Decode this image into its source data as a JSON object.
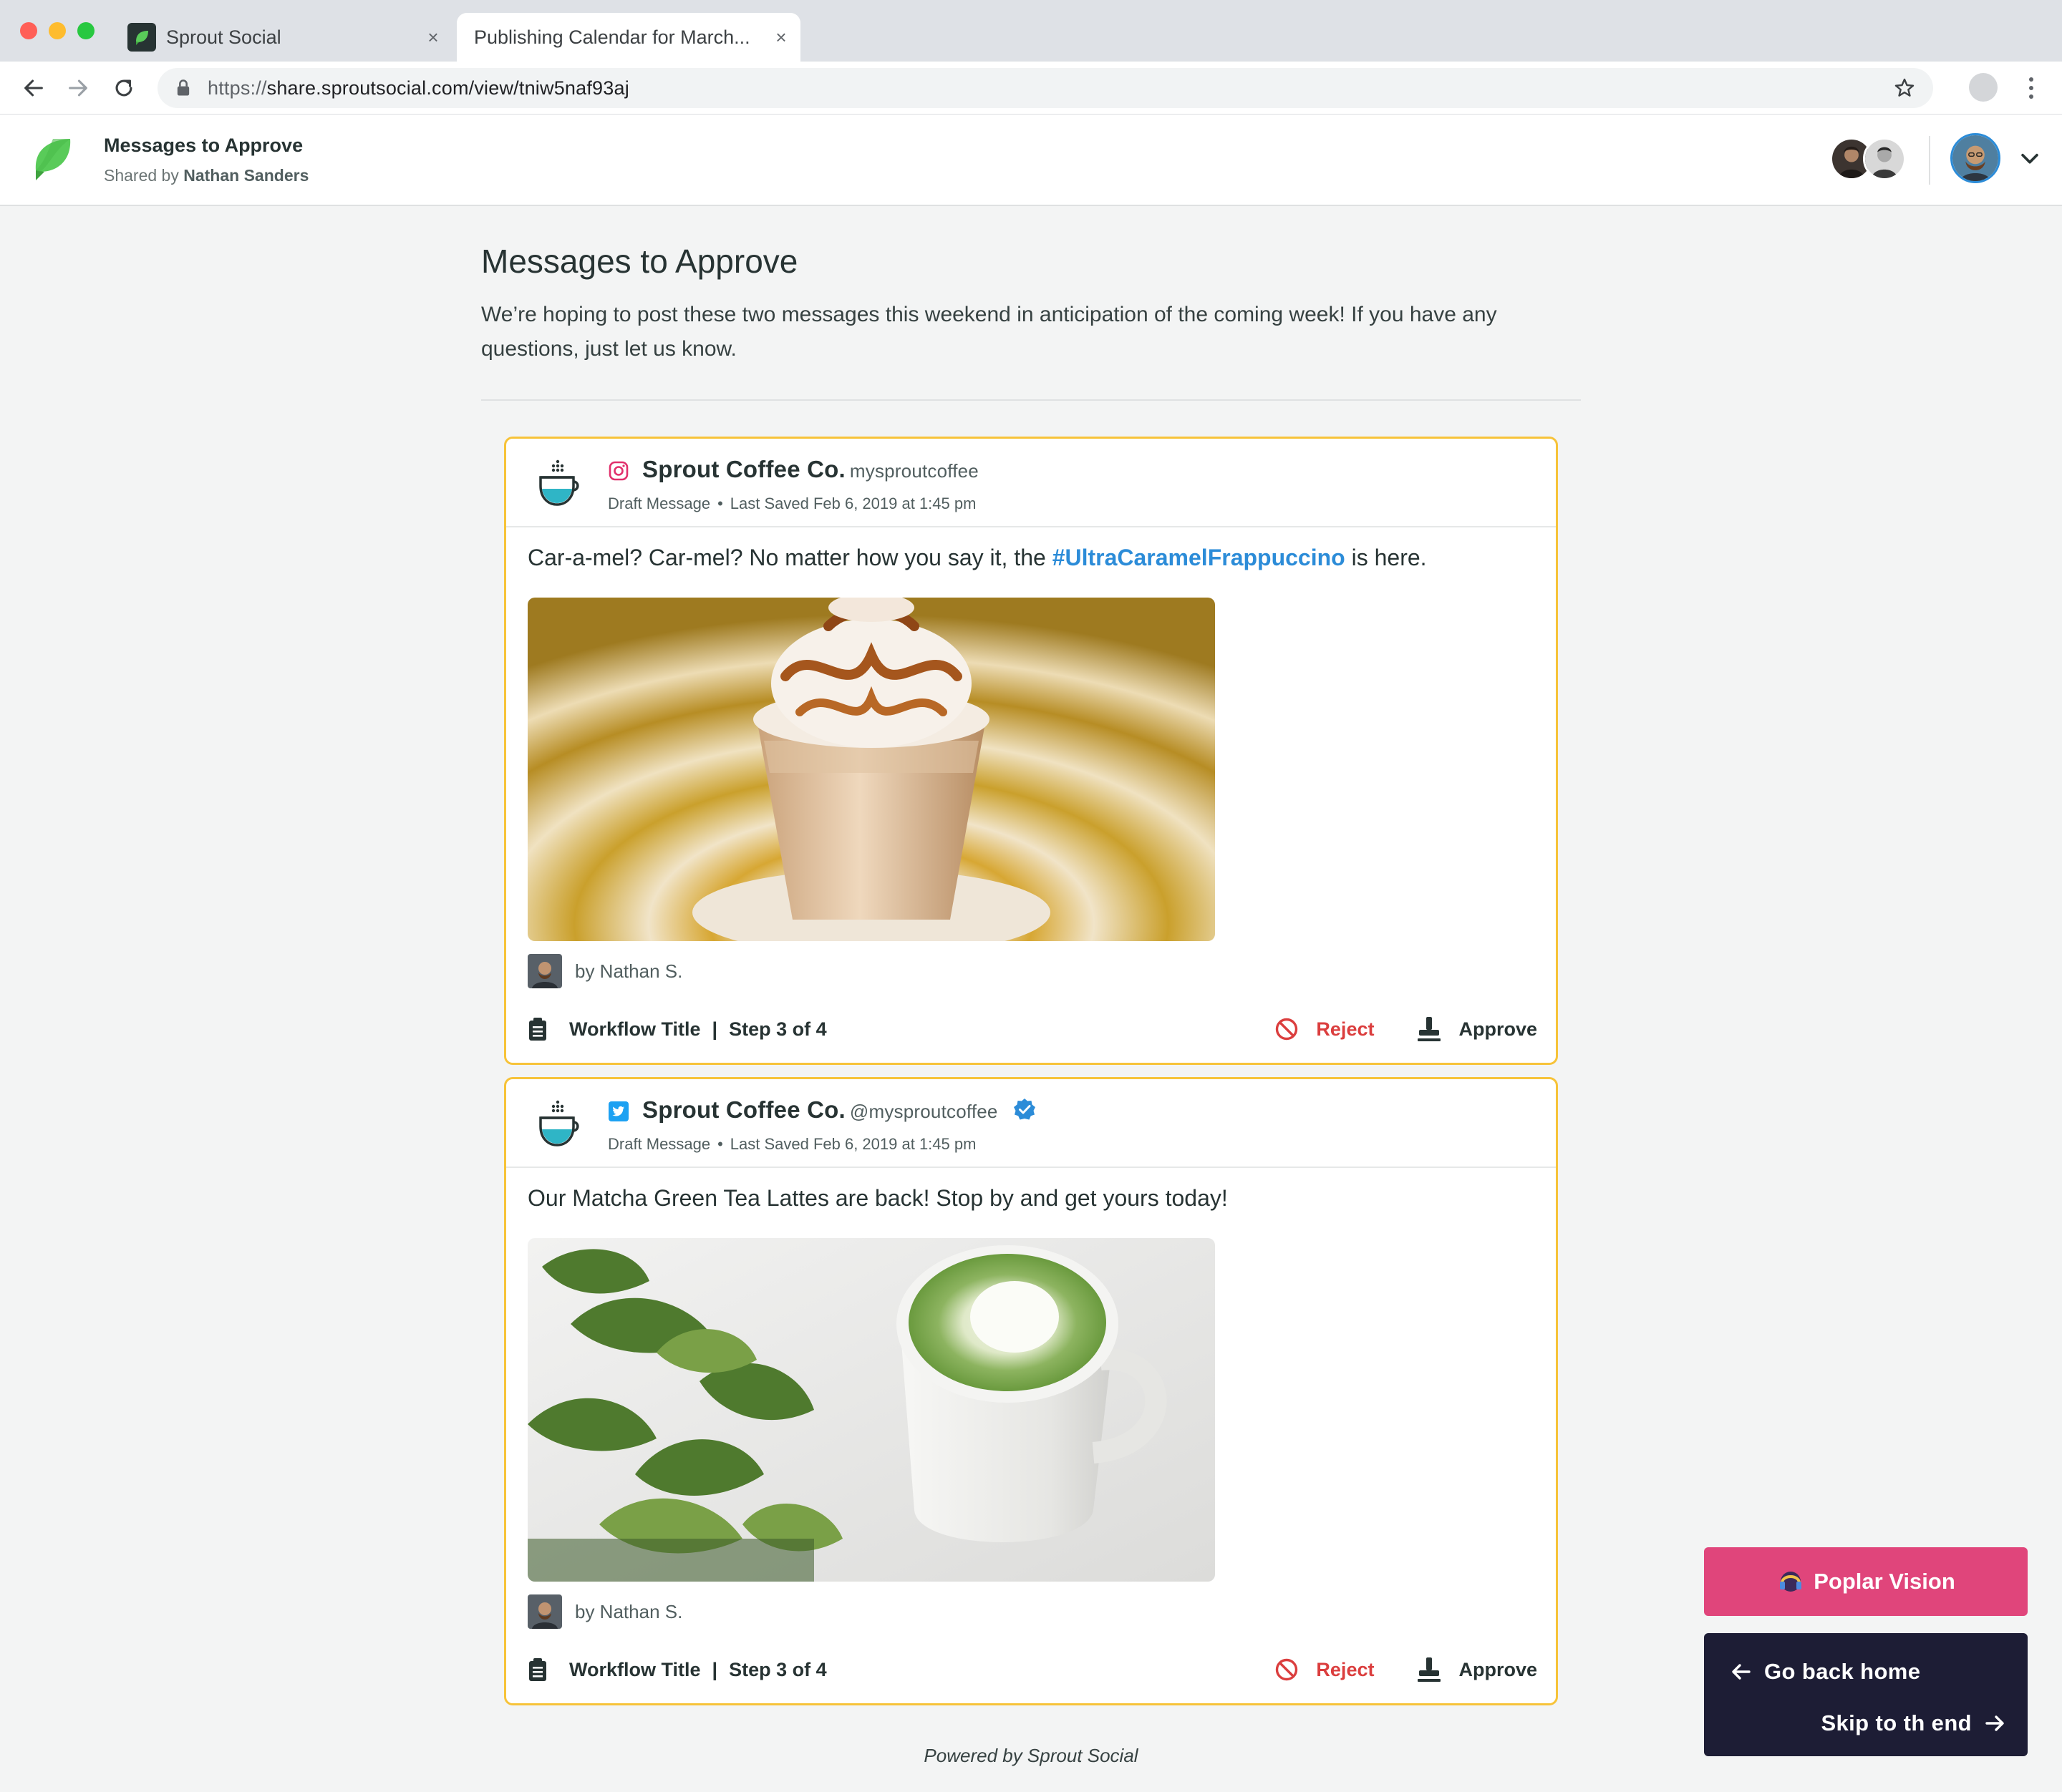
{
  "browser": {
    "tabs": [
      {
        "title": "Sprout Social",
        "close": "×"
      },
      {
        "title": "Publishing Calendar for March...",
        "close": "×"
      }
    ],
    "url": {
      "scheme": "https://",
      "rest": "share.sproutsocial.com/view/tniw5naf93aj"
    }
  },
  "header": {
    "title": "Messages to Approve",
    "shared_prefix": "Shared by ",
    "shared_by": "Nathan Sanders"
  },
  "page": {
    "heading": "Messages to Approve",
    "description": "We’re hoping to post these two messages this weekend in anticipation of the coming week! If you have any questions, just let us know."
  },
  "messages": [
    {
      "network": "instagram-icon",
      "brand": "Sprout Coffee Co.",
      "handle": "mysproutcoffee",
      "status": "Draft Message",
      "saved": "Last Saved Feb 6, 2019 at 1:45 pm",
      "text_before": "Car-a-mel? Car-mel? No matter how you say it, the ",
      "hashtag": "#UltraCaramelFrappuccino",
      "text_after": " is here.",
      "author": "by Nathan S.",
      "workflow": "Workflow Title",
      "separator": "|",
      "step": "Step 3 of 4",
      "reject": "Reject",
      "approve": "Approve"
    },
    {
      "network": "twitter-icon",
      "brand": "Sprout Coffee Co.",
      "handle": "@mysproutcoffee",
      "status": "Draft Message",
      "saved": "Last Saved Feb 6, 2019 at 1:45 pm",
      "text": "Our Matcha Green Tea Lattes are back! Stop by and get yours today!",
      "author": "by Nathan S.",
      "workflow": "Workflow Title",
      "separator": "|",
      "step": "Step 3 of 4",
      "reject": "Reject",
      "approve": "Approve"
    }
  ],
  "footer": {
    "powered": "Powered by Sprout Social"
  },
  "widget": {
    "brand_button": "Poplar Vision",
    "back": "Go back home",
    "skip": "Skip to th end"
  },
  "colors": {
    "card_border": "#f7c339",
    "link": "#2c8cd8",
    "reject": "#db3e3e",
    "widget_pink": "#e0457b",
    "widget_navy": "#1d1d35"
  }
}
